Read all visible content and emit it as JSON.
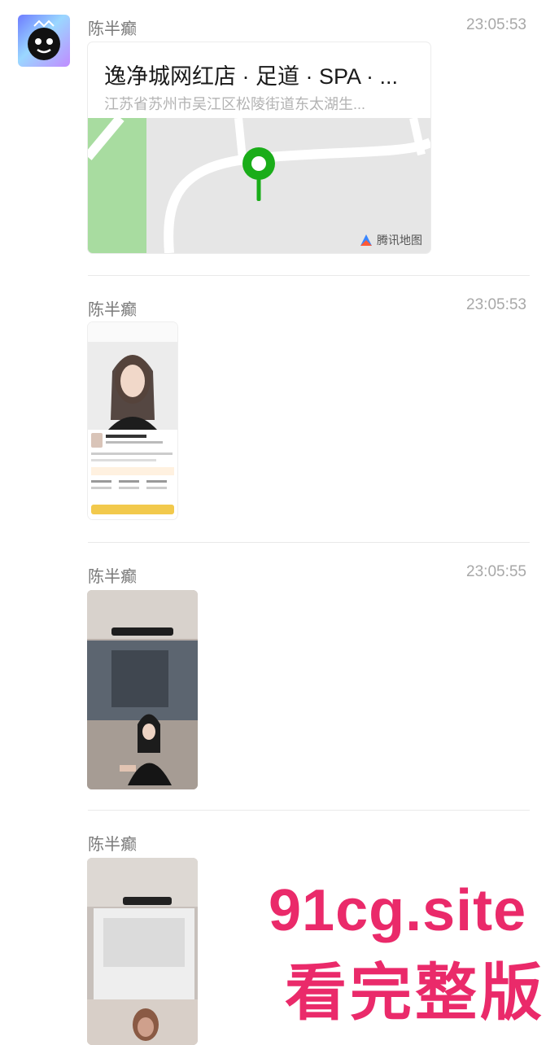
{
  "messages": [
    {
      "sender": "陈半癫",
      "time": "23:05:53",
      "location": {
        "title": "逸净城网红店 · 足道 · SPA · ...",
        "address": "江苏省苏州市吴江区松陵街道东太湖生...",
        "map_credit": "腾讯地图"
      }
    },
    {
      "sender": "陈半癫",
      "time": "23:05:53"
    },
    {
      "sender": "陈半癫",
      "time": "23:05:55"
    },
    {
      "sender": "陈半癫"
    }
  ],
  "watermark": {
    "line1": "91cg.site",
    "line2": "看完整版"
  },
  "colors": {
    "pin": "#1aad19",
    "watermark": "#ea2a6a",
    "phone_button": "#f2c94c"
  }
}
